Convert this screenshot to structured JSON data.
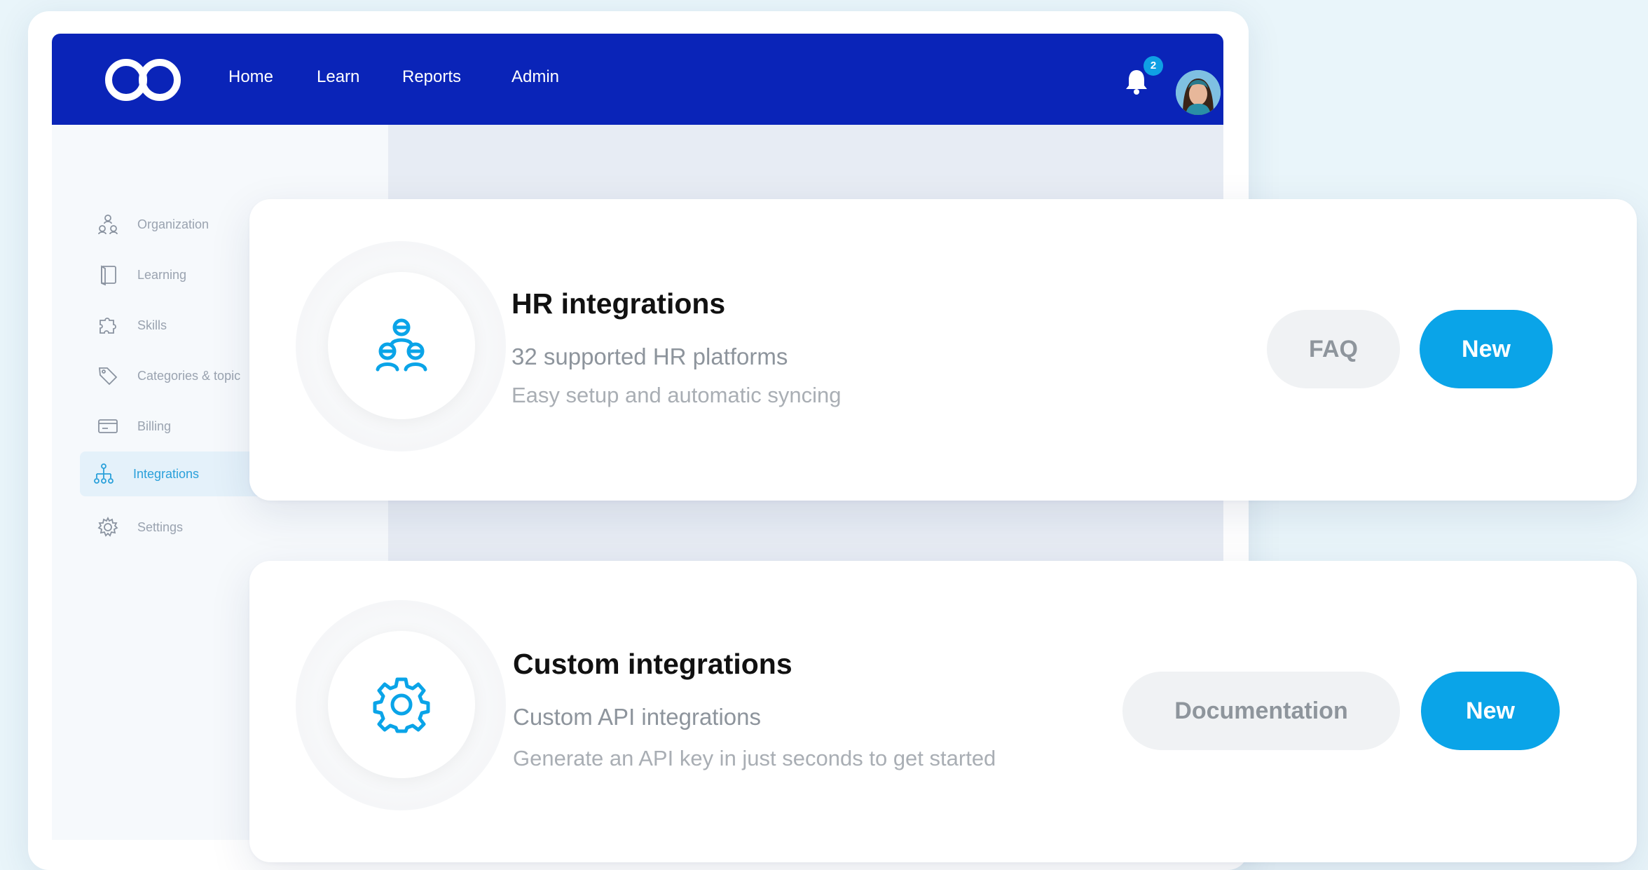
{
  "colors": {
    "nav_bg": "#0a24b8",
    "accent": "#0aa4e8",
    "badge": "#0fa0e4"
  },
  "nav": {
    "links": [
      "Home",
      "Learn",
      "Reports",
      "Admin"
    ],
    "notification_count": "2"
  },
  "sidebar": {
    "items": [
      {
        "label": "Organization",
        "icon": "organization-icon"
      },
      {
        "label": "Learning",
        "icon": "book-icon"
      },
      {
        "label": "Skills",
        "icon": "puzzle-icon"
      },
      {
        "label": "Categories & topic",
        "icon": "tag-icon"
      },
      {
        "label": "Billing",
        "icon": "billing-icon"
      },
      {
        "label": "Integrations",
        "icon": "integrations-icon",
        "active": true
      },
      {
        "label": "Settings",
        "icon": "gear-icon"
      }
    ]
  },
  "hr_card": {
    "title": "HR integrations",
    "subtitle": "32 supported HR platforms",
    "description": "Easy setup and automatic syncing",
    "secondary_label": "FAQ",
    "primary_label": "New",
    "icon": "people-group-icon"
  },
  "custom_card": {
    "title": "Custom integrations",
    "subtitle": "Custom API integrations",
    "description": "Generate an API key in just seconds to get started",
    "secondary_label": "Documentation",
    "primary_label": "New",
    "icon": "gear-icon"
  }
}
